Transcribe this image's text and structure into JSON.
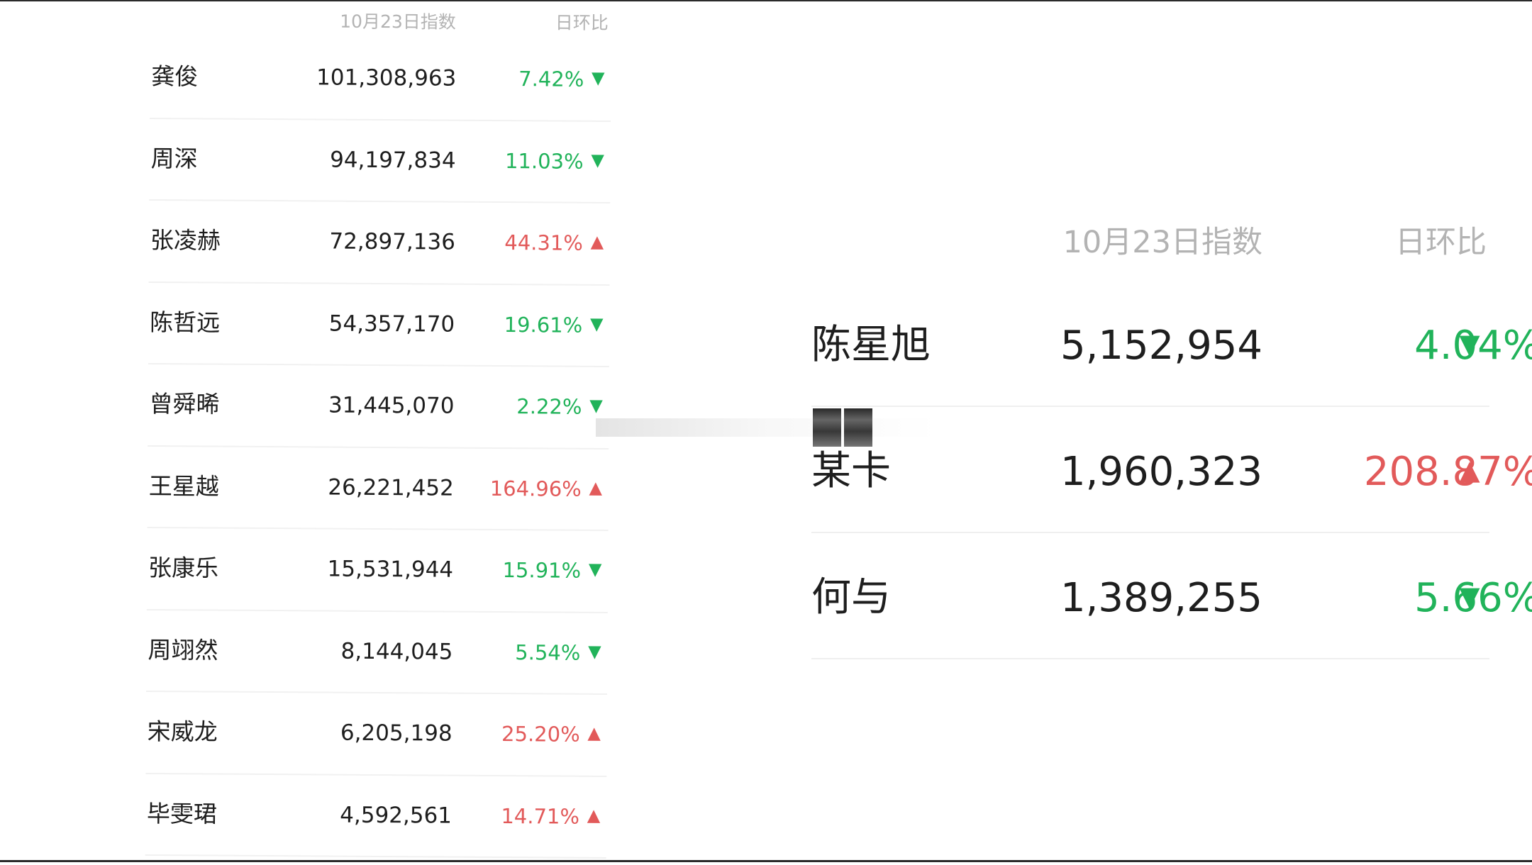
{
  "left_table": {
    "header_index": "10月23日指数",
    "header_change": "日环比",
    "rows": [
      {
        "name": "龚俊",
        "value": "101,308,963",
        "change": "7.42%",
        "dir": "down"
      },
      {
        "name": "周深",
        "value": "94,197,834",
        "change": "11.03%",
        "dir": "down"
      },
      {
        "name": "张凌赫",
        "value": "72,897,136",
        "change": "44.31%",
        "dir": "up"
      },
      {
        "name": "陈哲远",
        "value": "54,357,170",
        "change": "19.61%",
        "dir": "down"
      },
      {
        "name": "曾舜晞",
        "value": "31,445,070",
        "change": "2.22%",
        "dir": "down"
      },
      {
        "name": "王星越",
        "value": "26,221,452",
        "change": "164.96%",
        "dir": "up"
      },
      {
        "name": "张康乐",
        "value": "15,531,944",
        "change": "15.91%",
        "dir": "down"
      },
      {
        "name": "周翊然",
        "value": "8,144,045",
        "change": "5.54%",
        "dir": "down"
      },
      {
        "name": "宋威龙",
        "value": "6,205,198",
        "change": "25.20%",
        "dir": "up"
      },
      {
        "name": "毕雯珺",
        "value": "4,592,561",
        "change": "14.71%",
        "dir": "up"
      }
    ]
  },
  "right_table": {
    "header_index": "10月23日指数",
    "header_change": "日环比",
    "rows": [
      {
        "name": "陈星旭",
        "value": "5,152,954",
        "change": "4.04%",
        "dir": "down"
      },
      {
        "name": "某卡",
        "value": "1,960,323",
        "change": "208.87%",
        "dir": "up"
      },
      {
        "name": "何与",
        "value": "1,389,255",
        "change": "5.66%",
        "dir": "down"
      }
    ]
  },
  "glyphs": {
    "down": "▼",
    "up": "▲"
  },
  "colors": {
    "down": "#21b35a",
    "up": "#e25a5a",
    "header": "#b3b3b3"
  }
}
